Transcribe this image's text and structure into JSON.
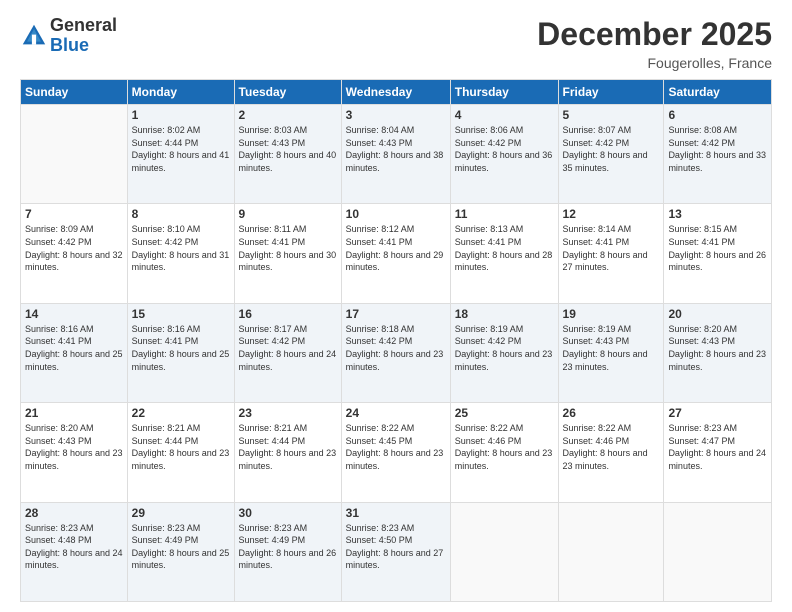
{
  "logo": {
    "general": "General",
    "blue": "Blue"
  },
  "title": "December 2025",
  "location": "Fougerolles, France",
  "days_header": [
    "Sunday",
    "Monday",
    "Tuesday",
    "Wednesday",
    "Thursday",
    "Friday",
    "Saturday"
  ],
  "weeks": [
    [
      {
        "day": "",
        "sunrise": "",
        "sunset": "",
        "daylight": ""
      },
      {
        "day": "1",
        "sunrise": "Sunrise: 8:02 AM",
        "sunset": "Sunset: 4:44 PM",
        "daylight": "Daylight: 8 hours and 41 minutes."
      },
      {
        "day": "2",
        "sunrise": "Sunrise: 8:03 AM",
        "sunset": "Sunset: 4:43 PM",
        "daylight": "Daylight: 8 hours and 40 minutes."
      },
      {
        "day": "3",
        "sunrise": "Sunrise: 8:04 AM",
        "sunset": "Sunset: 4:43 PM",
        "daylight": "Daylight: 8 hours and 38 minutes."
      },
      {
        "day": "4",
        "sunrise": "Sunrise: 8:06 AM",
        "sunset": "Sunset: 4:42 PM",
        "daylight": "Daylight: 8 hours and 36 minutes."
      },
      {
        "day": "5",
        "sunrise": "Sunrise: 8:07 AM",
        "sunset": "Sunset: 4:42 PM",
        "daylight": "Daylight: 8 hours and 35 minutes."
      },
      {
        "day": "6",
        "sunrise": "Sunrise: 8:08 AM",
        "sunset": "Sunset: 4:42 PM",
        "daylight": "Daylight: 8 hours and 33 minutes."
      }
    ],
    [
      {
        "day": "7",
        "sunrise": "Sunrise: 8:09 AM",
        "sunset": "Sunset: 4:42 PM",
        "daylight": "Daylight: 8 hours and 32 minutes."
      },
      {
        "day": "8",
        "sunrise": "Sunrise: 8:10 AM",
        "sunset": "Sunset: 4:42 PM",
        "daylight": "Daylight: 8 hours and 31 minutes."
      },
      {
        "day": "9",
        "sunrise": "Sunrise: 8:11 AM",
        "sunset": "Sunset: 4:41 PM",
        "daylight": "Daylight: 8 hours and 30 minutes."
      },
      {
        "day": "10",
        "sunrise": "Sunrise: 8:12 AM",
        "sunset": "Sunset: 4:41 PM",
        "daylight": "Daylight: 8 hours and 29 minutes."
      },
      {
        "day": "11",
        "sunrise": "Sunrise: 8:13 AM",
        "sunset": "Sunset: 4:41 PM",
        "daylight": "Daylight: 8 hours and 28 minutes."
      },
      {
        "day": "12",
        "sunrise": "Sunrise: 8:14 AM",
        "sunset": "Sunset: 4:41 PM",
        "daylight": "Daylight: 8 hours and 27 minutes."
      },
      {
        "day": "13",
        "sunrise": "Sunrise: 8:15 AM",
        "sunset": "Sunset: 4:41 PM",
        "daylight": "Daylight: 8 hours and 26 minutes."
      }
    ],
    [
      {
        "day": "14",
        "sunrise": "Sunrise: 8:16 AM",
        "sunset": "Sunset: 4:41 PM",
        "daylight": "Daylight: 8 hours and 25 minutes."
      },
      {
        "day": "15",
        "sunrise": "Sunrise: 8:16 AM",
        "sunset": "Sunset: 4:41 PM",
        "daylight": "Daylight: 8 hours and 25 minutes."
      },
      {
        "day": "16",
        "sunrise": "Sunrise: 8:17 AM",
        "sunset": "Sunset: 4:42 PM",
        "daylight": "Daylight: 8 hours and 24 minutes."
      },
      {
        "day": "17",
        "sunrise": "Sunrise: 8:18 AM",
        "sunset": "Sunset: 4:42 PM",
        "daylight": "Daylight: 8 hours and 23 minutes."
      },
      {
        "day": "18",
        "sunrise": "Sunrise: 8:19 AM",
        "sunset": "Sunset: 4:42 PM",
        "daylight": "Daylight: 8 hours and 23 minutes."
      },
      {
        "day": "19",
        "sunrise": "Sunrise: 8:19 AM",
        "sunset": "Sunset: 4:43 PM",
        "daylight": "Daylight: 8 hours and 23 minutes."
      },
      {
        "day": "20",
        "sunrise": "Sunrise: 8:20 AM",
        "sunset": "Sunset: 4:43 PM",
        "daylight": "Daylight: 8 hours and 23 minutes."
      }
    ],
    [
      {
        "day": "21",
        "sunrise": "Sunrise: 8:20 AM",
        "sunset": "Sunset: 4:43 PM",
        "daylight": "Daylight: 8 hours and 23 minutes."
      },
      {
        "day": "22",
        "sunrise": "Sunrise: 8:21 AM",
        "sunset": "Sunset: 4:44 PM",
        "daylight": "Daylight: 8 hours and 23 minutes."
      },
      {
        "day": "23",
        "sunrise": "Sunrise: 8:21 AM",
        "sunset": "Sunset: 4:44 PM",
        "daylight": "Daylight: 8 hours and 23 minutes."
      },
      {
        "day": "24",
        "sunrise": "Sunrise: 8:22 AM",
        "sunset": "Sunset: 4:45 PM",
        "daylight": "Daylight: 8 hours and 23 minutes."
      },
      {
        "day": "25",
        "sunrise": "Sunrise: 8:22 AM",
        "sunset": "Sunset: 4:46 PM",
        "daylight": "Daylight: 8 hours and 23 minutes."
      },
      {
        "day": "26",
        "sunrise": "Sunrise: 8:22 AM",
        "sunset": "Sunset: 4:46 PM",
        "daylight": "Daylight: 8 hours and 23 minutes."
      },
      {
        "day": "27",
        "sunrise": "Sunrise: 8:23 AM",
        "sunset": "Sunset: 4:47 PM",
        "daylight": "Daylight: 8 hours and 24 minutes."
      }
    ],
    [
      {
        "day": "28",
        "sunrise": "Sunrise: 8:23 AM",
        "sunset": "Sunset: 4:48 PM",
        "daylight": "Daylight: 8 hours and 24 minutes."
      },
      {
        "day": "29",
        "sunrise": "Sunrise: 8:23 AM",
        "sunset": "Sunset: 4:49 PM",
        "daylight": "Daylight: 8 hours and 25 minutes."
      },
      {
        "day": "30",
        "sunrise": "Sunrise: 8:23 AM",
        "sunset": "Sunset: 4:49 PM",
        "daylight": "Daylight: 8 hours and 26 minutes."
      },
      {
        "day": "31",
        "sunrise": "Sunrise: 8:23 AM",
        "sunset": "Sunset: 4:50 PM",
        "daylight": "Daylight: 8 hours and 27 minutes."
      },
      {
        "day": "",
        "sunrise": "",
        "sunset": "",
        "daylight": ""
      },
      {
        "day": "",
        "sunrise": "",
        "sunset": "",
        "daylight": ""
      },
      {
        "day": "",
        "sunrise": "",
        "sunset": "",
        "daylight": ""
      }
    ]
  ]
}
